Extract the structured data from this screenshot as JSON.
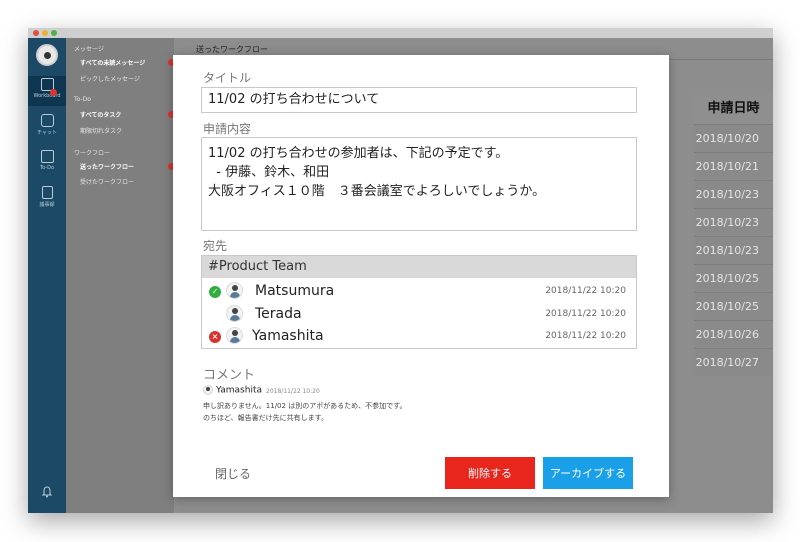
{
  "sidebar": {
    "rail": [
      {
        "label": "Workboard",
        "icon": "document-icon"
      },
      {
        "label": "チャット",
        "icon": "chat-icon"
      },
      {
        "label": "To-Do",
        "icon": "checkbox-icon"
      },
      {
        "label": "議事録",
        "icon": "notebook-icon"
      }
    ],
    "bell_icon": "bell-icon"
  },
  "panel": {
    "messages_header": "メッセージ",
    "unread_messages": "すべての未読メッセージ",
    "picked_messages": "ピックしたメッセージ",
    "todo_header": "To-Do",
    "all_tasks": "すべてのタスク",
    "overdue_tasks": "期限切れタスク",
    "workflow_header": "ワークフロー",
    "sent_workflow": "送ったワークフロー",
    "received_workflow": "受けたワークフロー"
  },
  "main": {
    "header_title": "送ったワークフロー",
    "date_column_header": "申請日時",
    "dates": [
      "2018/10/20",
      "2018/10/21",
      "2018/10/23",
      "2018/10/23",
      "2018/10/23",
      "2018/10/25",
      "2018/10/25",
      "2018/10/26",
      "2018/10/27"
    ]
  },
  "modal": {
    "title_label": "タイトル",
    "title_value": "11/02 の打ち合わせについて",
    "content_label": "申請内容",
    "content_lines": [
      "11/02 の打ち合わせの参加者は、下記の予定です。",
      "  - 伊藤、鈴木、和田",
      "",
      "大阪オフィス１０階　３番会議室でよろしいでしょうか。"
    ],
    "destination_label": "宛先",
    "group": "#Product Team",
    "recipients": [
      {
        "name": "Matsumura",
        "date": "2018/11/22 10:20",
        "status": "approved"
      },
      {
        "name": "Terada",
        "date": "2018/11/22 10:20",
        "status": "none"
      },
      {
        "name": "Yamashita",
        "date": "2018/11/22 10:20",
        "status": "rejected"
      }
    ],
    "comment_label": "コメント",
    "comment": {
      "author": "Yamashita",
      "date": "2018/11/22 10:20",
      "lines": [
        "申し訳ありません。11/02 は別のアポがあるため、不参加です。",
        "のちほど、報告書だけ先に共有します。"
      ]
    },
    "close_label": "閉じる",
    "delete_label": "削除する",
    "archive_label": "アーカイブする"
  },
  "colors": {
    "rail": "#1c4a66",
    "delete": "#e8261d",
    "archive": "#1aa0e8",
    "approved": "#2fae3f",
    "rejected": "#d9322b"
  }
}
